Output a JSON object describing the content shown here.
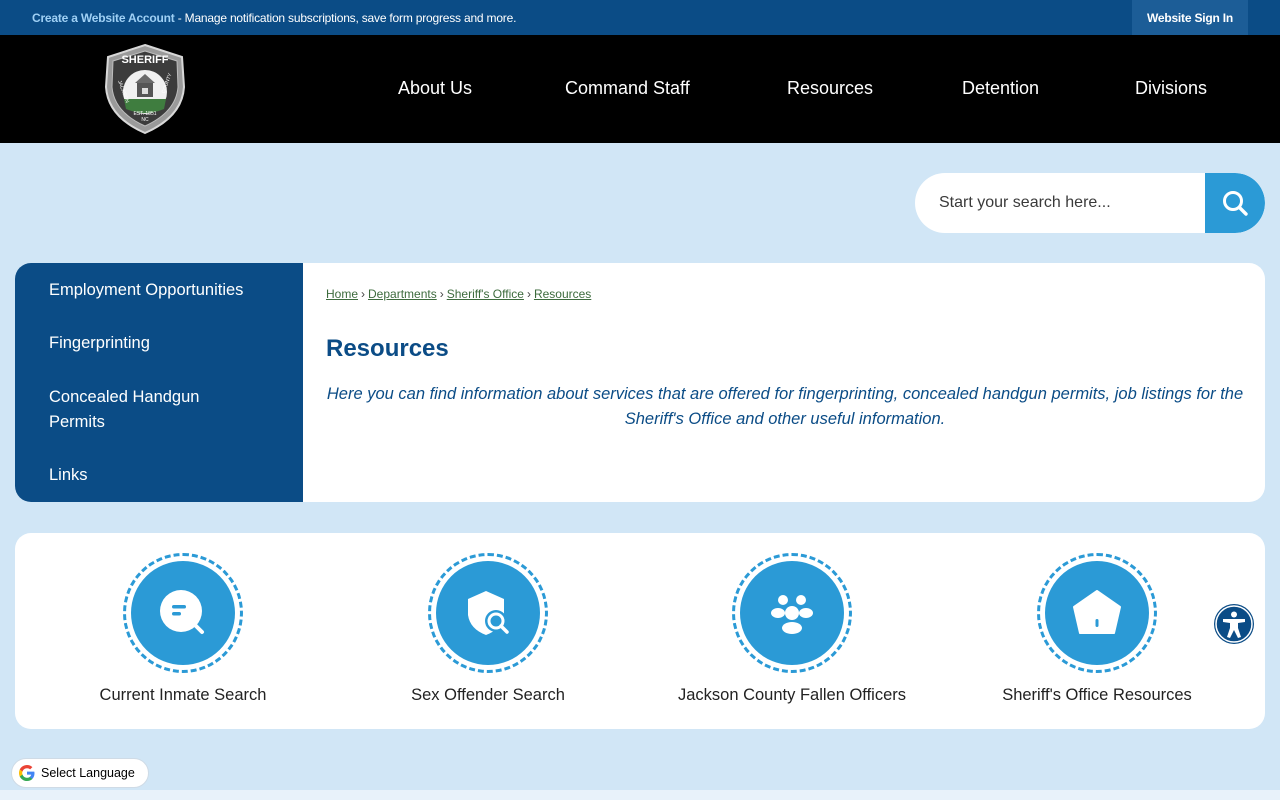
{
  "topbar": {
    "create_account_link": "Create a Website Account",
    "notice_text": " - Manage notification subscriptions, save form progress and more.",
    "sign_in": "Website Sign In"
  },
  "logo": {
    "text_top": "SHERIFF",
    "text_left": "JACKSON",
    "text_right": "COUNTY",
    "text_est": "EST. 1851",
    "text_nc": "NC"
  },
  "nav": {
    "items": [
      "About Us",
      "Command Staff",
      "Resources",
      "Detention",
      "Divisions"
    ]
  },
  "search": {
    "placeholder": "Start your search here..."
  },
  "sidenav": {
    "items": [
      "Employment Opportunities",
      "Fingerprinting",
      "Concealed Handgun Permits",
      "Links"
    ]
  },
  "breadcrumb": [
    "Home",
    "Departments",
    "Sheriff's Office",
    "Resources"
  ],
  "main": {
    "title": "Resources",
    "intro": "Here you can find information about services that are offered for fingerprinting, concealed handgun permits, job listings for the Sheriff's Office and other useful information."
  },
  "quick_links": [
    {
      "label": "Current Inmate Search",
      "icon": "search-doc-icon"
    },
    {
      "label": "Sex Offender Search",
      "icon": "shield-search-icon"
    },
    {
      "label": "Jackson County Fallen Officers",
      "icon": "group-icon"
    },
    {
      "label": "Sheriff's Office Resources",
      "icon": "home-icon"
    }
  ],
  "language": {
    "label": "Select Language"
  },
  "colors": {
    "primary": "#0b4c86",
    "accent": "#2b9ad6",
    "background": "#d1e6f6"
  }
}
